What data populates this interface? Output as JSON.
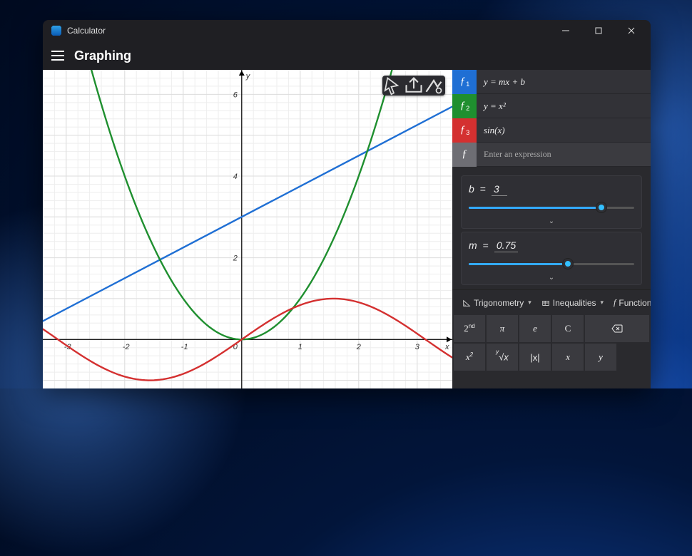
{
  "app": {
    "title": "Calculator",
    "mode": "Graphing"
  },
  "functions": [
    {
      "color": "#1f6fd4",
      "label_index": "1",
      "expression": "y = mx + b"
    },
    {
      "color": "#1f8f2f",
      "label_index": "2",
      "expression": "y = x²"
    },
    {
      "color": "#d43030",
      "label_index": "3",
      "expression": "sin(x)"
    }
  ],
  "function_placeholder": "Enter an expression",
  "variables": [
    {
      "name": "b",
      "value": "3",
      "slider_percent": 80
    },
    {
      "name": "m",
      "value": "0.75",
      "slider_percent": 60
    }
  ],
  "categories": {
    "trig": "Trigonometry",
    "ineq": "Inequalities",
    "func": "Function"
  },
  "keypad": {
    "row1": [
      "2",
      "π",
      "e",
      "C",
      "⌫"
    ],
    "row2": [
      "x²",
      "ʸ√x",
      "|x|",
      "x",
      "y"
    ]
  },
  "chart_data": {
    "type": "line",
    "xlabel": "x",
    "ylabel": "y",
    "xlim": [
      -3.4,
      3.6
    ],
    "ylim": [
      -1.2,
      6.6
    ],
    "x_ticks": [
      -3,
      -2,
      -1,
      0,
      1,
      2,
      3
    ],
    "y_ticks": [
      0,
      2,
      4,
      6
    ],
    "series": [
      {
        "name": "y = mx + b",
        "color": "#1f6fd4",
        "params": {
          "m": 0.75,
          "b": 3
        },
        "points": [
          [
            -3.4,
            0.45
          ],
          [
            3.6,
            5.7
          ]
        ]
      },
      {
        "name": "y = x²",
        "color": "#1f8f2f",
        "points": [
          [
            -2.6,
            6.76
          ],
          [
            -2,
            4
          ],
          [
            -1.5,
            2.25
          ],
          [
            -1,
            1
          ],
          [
            -0.5,
            0.25
          ],
          [
            0,
            0
          ],
          [
            0.5,
            0.25
          ],
          [
            1,
            1
          ],
          [
            1.5,
            2.25
          ],
          [
            2,
            4
          ],
          [
            2.6,
            6.76
          ]
        ]
      },
      {
        "name": "sin(x)",
        "color": "#d43030",
        "points": [
          [
            -3.4,
            0.26
          ],
          [
            -3,
            -0.14
          ],
          [
            -2.5,
            -0.6
          ],
          [
            -2,
            -0.91
          ],
          [
            -1.5,
            -1.0
          ],
          [
            -1,
            -0.84
          ],
          [
            -0.5,
            -0.48
          ],
          [
            0,
            0
          ],
          [
            0.5,
            0.48
          ],
          [
            1,
            0.84
          ],
          [
            1.5,
            1.0
          ],
          [
            2,
            0.91
          ],
          [
            2.5,
            0.6
          ],
          [
            3,
            0.14
          ],
          [
            3.6,
            -0.44
          ]
        ]
      }
    ]
  }
}
